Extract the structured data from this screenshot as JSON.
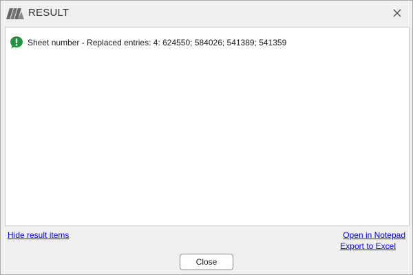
{
  "window": {
    "title": "RESULT",
    "close_icon": "close-icon",
    "logo_icon": "app-logo-icon"
  },
  "results": [
    {
      "icon": "speech-bubble-exclamation-icon",
      "icon_color": "#1a9a3a",
      "text": "Sheet number - Replaced entries: 4: 624550; 584026; 541389; 541359"
    }
  ],
  "footer": {
    "hide_link": "Hide result items",
    "notepad_link": "Open in Notepad",
    "excel_link": "Export to Excel",
    "close_label": "Close"
  },
  "colors": {
    "link": "#0000ee",
    "background": "#f0f0f0",
    "content_background": "#ffffff",
    "logo": "#5f5f5f"
  }
}
